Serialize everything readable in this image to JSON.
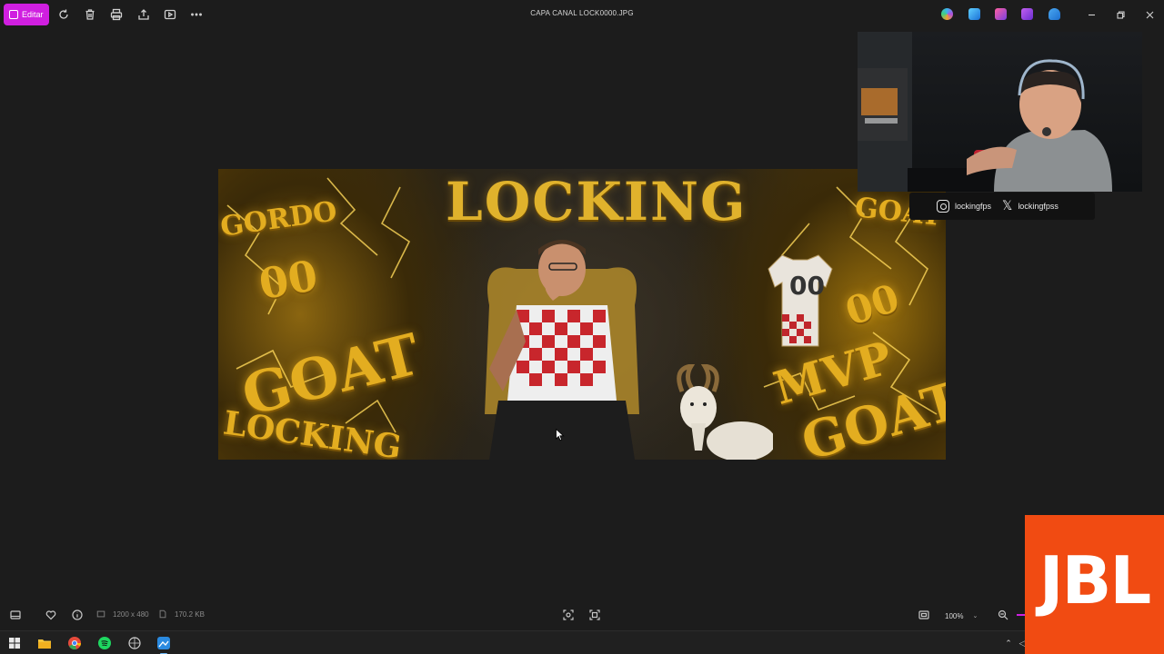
{
  "window": {
    "title": "CAPA CANAL LOCK0000.JPG",
    "edit_label": "Editar"
  },
  "toolbar": {
    "icons": [
      "rotate-icon",
      "delete-icon",
      "print-icon",
      "share-icon",
      "slideshow-icon",
      "more-icon"
    ]
  },
  "image": {
    "headline": "LOCKING",
    "decorations": [
      "GORDO",
      "00",
      "GOAT",
      "LOCKING",
      "GOAT",
      "00",
      "MVP",
      "GOAT"
    ],
    "jersey_number": "00"
  },
  "overlay": {
    "instagram_handle": "lockingfps",
    "x_handle": "lockingfpss"
  },
  "infobar": {
    "dimensions": "1200 x 480",
    "file_size": "170.2 KB",
    "zoom": "100%"
  },
  "brand_logo": "JBL",
  "colors": {
    "edit_accent": "#d01fe0",
    "jbl_orange": "#f14b12",
    "gold": "#e0b22c"
  }
}
